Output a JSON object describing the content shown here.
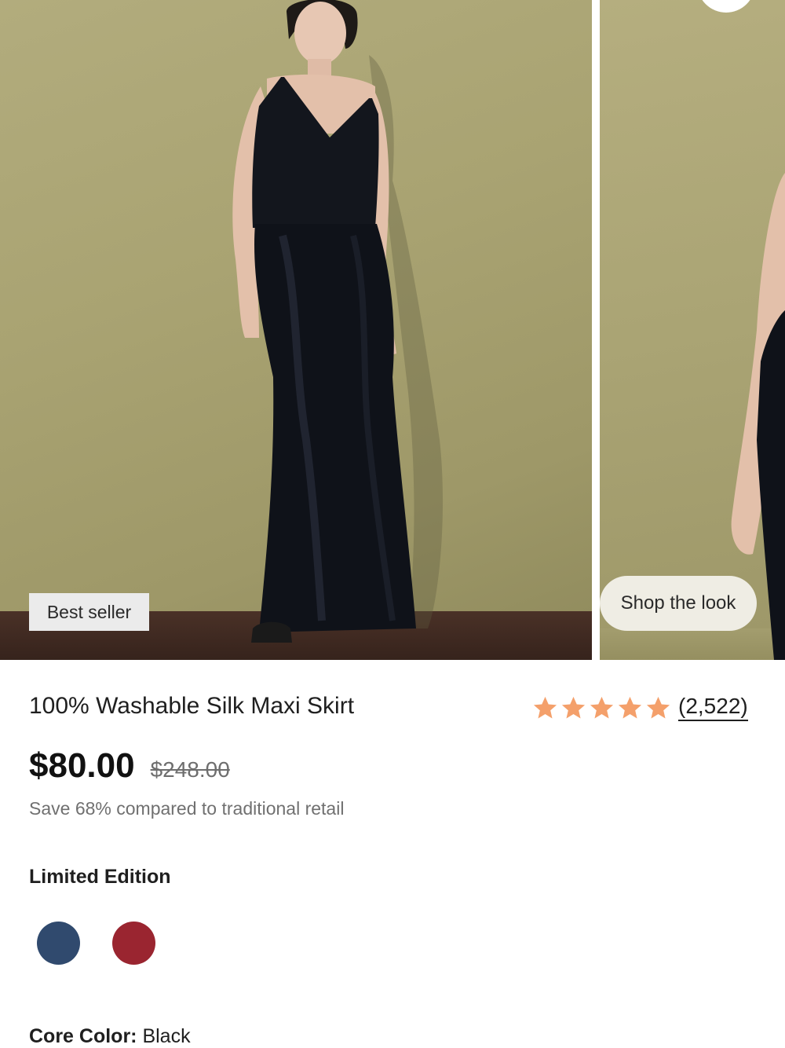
{
  "gallery": {
    "badge_label": "Best seller",
    "shop_the_look_label": "Shop the look",
    "image_alt": "model-wearing-black-silk-maxi-skirt"
  },
  "product": {
    "title": "100% Washable Silk Maxi Skirt",
    "rating_stars": 5,
    "review_count": "(2,522)",
    "price": "$80.00",
    "original_price": "$248.00",
    "savings_text": "Save 68% compared to traditional retail"
  },
  "colors": {
    "limited_label": "Limited Edition",
    "swatches": [
      {
        "name": "navy-swatch",
        "hex": "#304a6e"
      },
      {
        "name": "red-swatch",
        "hex": "#9a2530"
      }
    ],
    "core_label": "Core Color:",
    "core_value": "Black"
  },
  "theme": {
    "star_color": "#f4a06b",
    "wall_color": "#aaa474"
  }
}
